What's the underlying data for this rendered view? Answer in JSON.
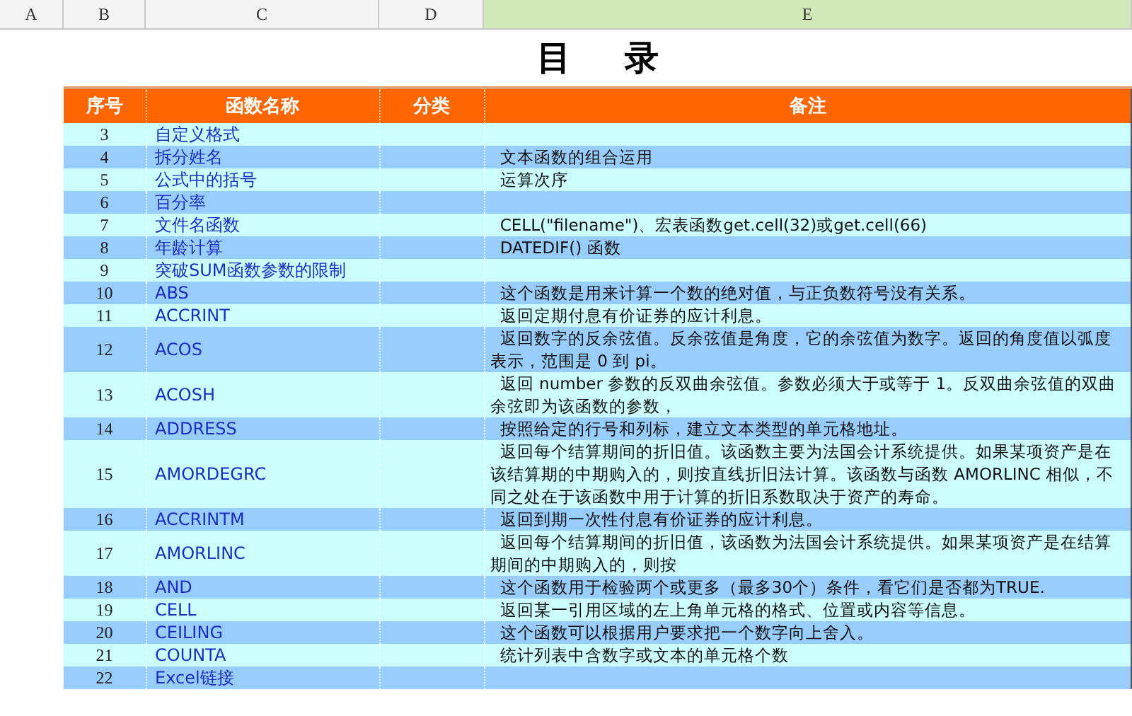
{
  "columns": [
    {
      "label": "A",
      "selected": false
    },
    {
      "label": "B",
      "selected": false
    },
    {
      "label": "C",
      "selected": false
    },
    {
      "label": "D",
      "selected": false
    },
    {
      "label": "E",
      "selected": true
    }
  ],
  "title": "目录",
  "table": {
    "headers": [
      "序号",
      "函数名称",
      "分类",
      "备注"
    ],
    "rows": [
      {
        "no": "3",
        "name": "自定义格式",
        "desc": ""
      },
      {
        "no": "4",
        "name": "拆分姓名",
        "desc": "文本函数的组合运用"
      },
      {
        "no": "5",
        "name": "公式中的括号",
        "desc": "运算次序"
      },
      {
        "no": "6",
        "name": "百分率",
        "desc": ""
      },
      {
        "no": "7",
        "name": "文件名函数",
        "desc": "CELL(\"filename\")、宏表函数get.cell(32)或get.cell(66)"
      },
      {
        "no": "8",
        "name": "年龄计算",
        "desc": "DATEDIF() 函数"
      },
      {
        "no": "9",
        "name": "突破SUM函数参数的限制",
        "desc": ""
      },
      {
        "no": "10",
        "name": "ABS",
        "desc": "这个函数是用来计算一个数的绝对值，与正负数符号没有关系。"
      },
      {
        "no": "11",
        "name": "ACCRINT",
        "desc": "返回定期付息有价证券的应计利息。"
      },
      {
        "no": "12",
        "name": "ACOS",
        "desc": "返回数字的反余弦值。反余弦值是角度，它的余弦值为数字。返回的角度值以弧度表示，范围是 0 到 pi。"
      },
      {
        "no": "13",
        "name": "ACOSH",
        "desc": "返回 number 参数的反双曲余弦值。参数必须大于或等于 1。反双曲余弦值的双曲余弦即为该函数的参数，"
      },
      {
        "no": "14",
        "name": "ADDRESS",
        "desc": "按照给定的行号和列标，建立文本类型的单元格地址。"
      },
      {
        "no": "15",
        "name": "AMORDEGRC",
        "desc": "返回每个结算期间的折旧值。该函数主要为法国会计系统提供。如果某项资产是在该结算期的中期购入的，则按直线折旧法计算。该函数与函数 AMORLINC 相似，不同之处在于该函数中用于计算的折旧系数取决于资产的寿命。"
      },
      {
        "no": "16",
        "name": "ACCRINTM",
        "desc": "返回到期一次性付息有价证券的应计利息。"
      },
      {
        "no": "17",
        "name": "AMORLINC",
        "desc": "返回每个结算期间的折旧值，该函数为法国会计系统提供。如果某项资产是在结算期间的中期购入的，则按"
      },
      {
        "no": "18",
        "name": "AND",
        "desc": "这个函数用于检验两个或更多（最多30个）条件，看它们是否都为TRUE."
      },
      {
        "no": "19",
        "name": "CELL",
        "desc": "返回某一引用区域的左上角单元格的格式、位置或内容等信息。"
      },
      {
        "no": "20",
        "name": "CEILING",
        "desc": "这个函数可以根据用户要求把一个数字向上舍入。"
      },
      {
        "no": "21",
        "name": "COUNTA",
        "desc": "统计列表中含数字或文本的单元格个数"
      },
      {
        "no": "22",
        "name": "Excel链接",
        "desc": ""
      }
    ]
  }
}
